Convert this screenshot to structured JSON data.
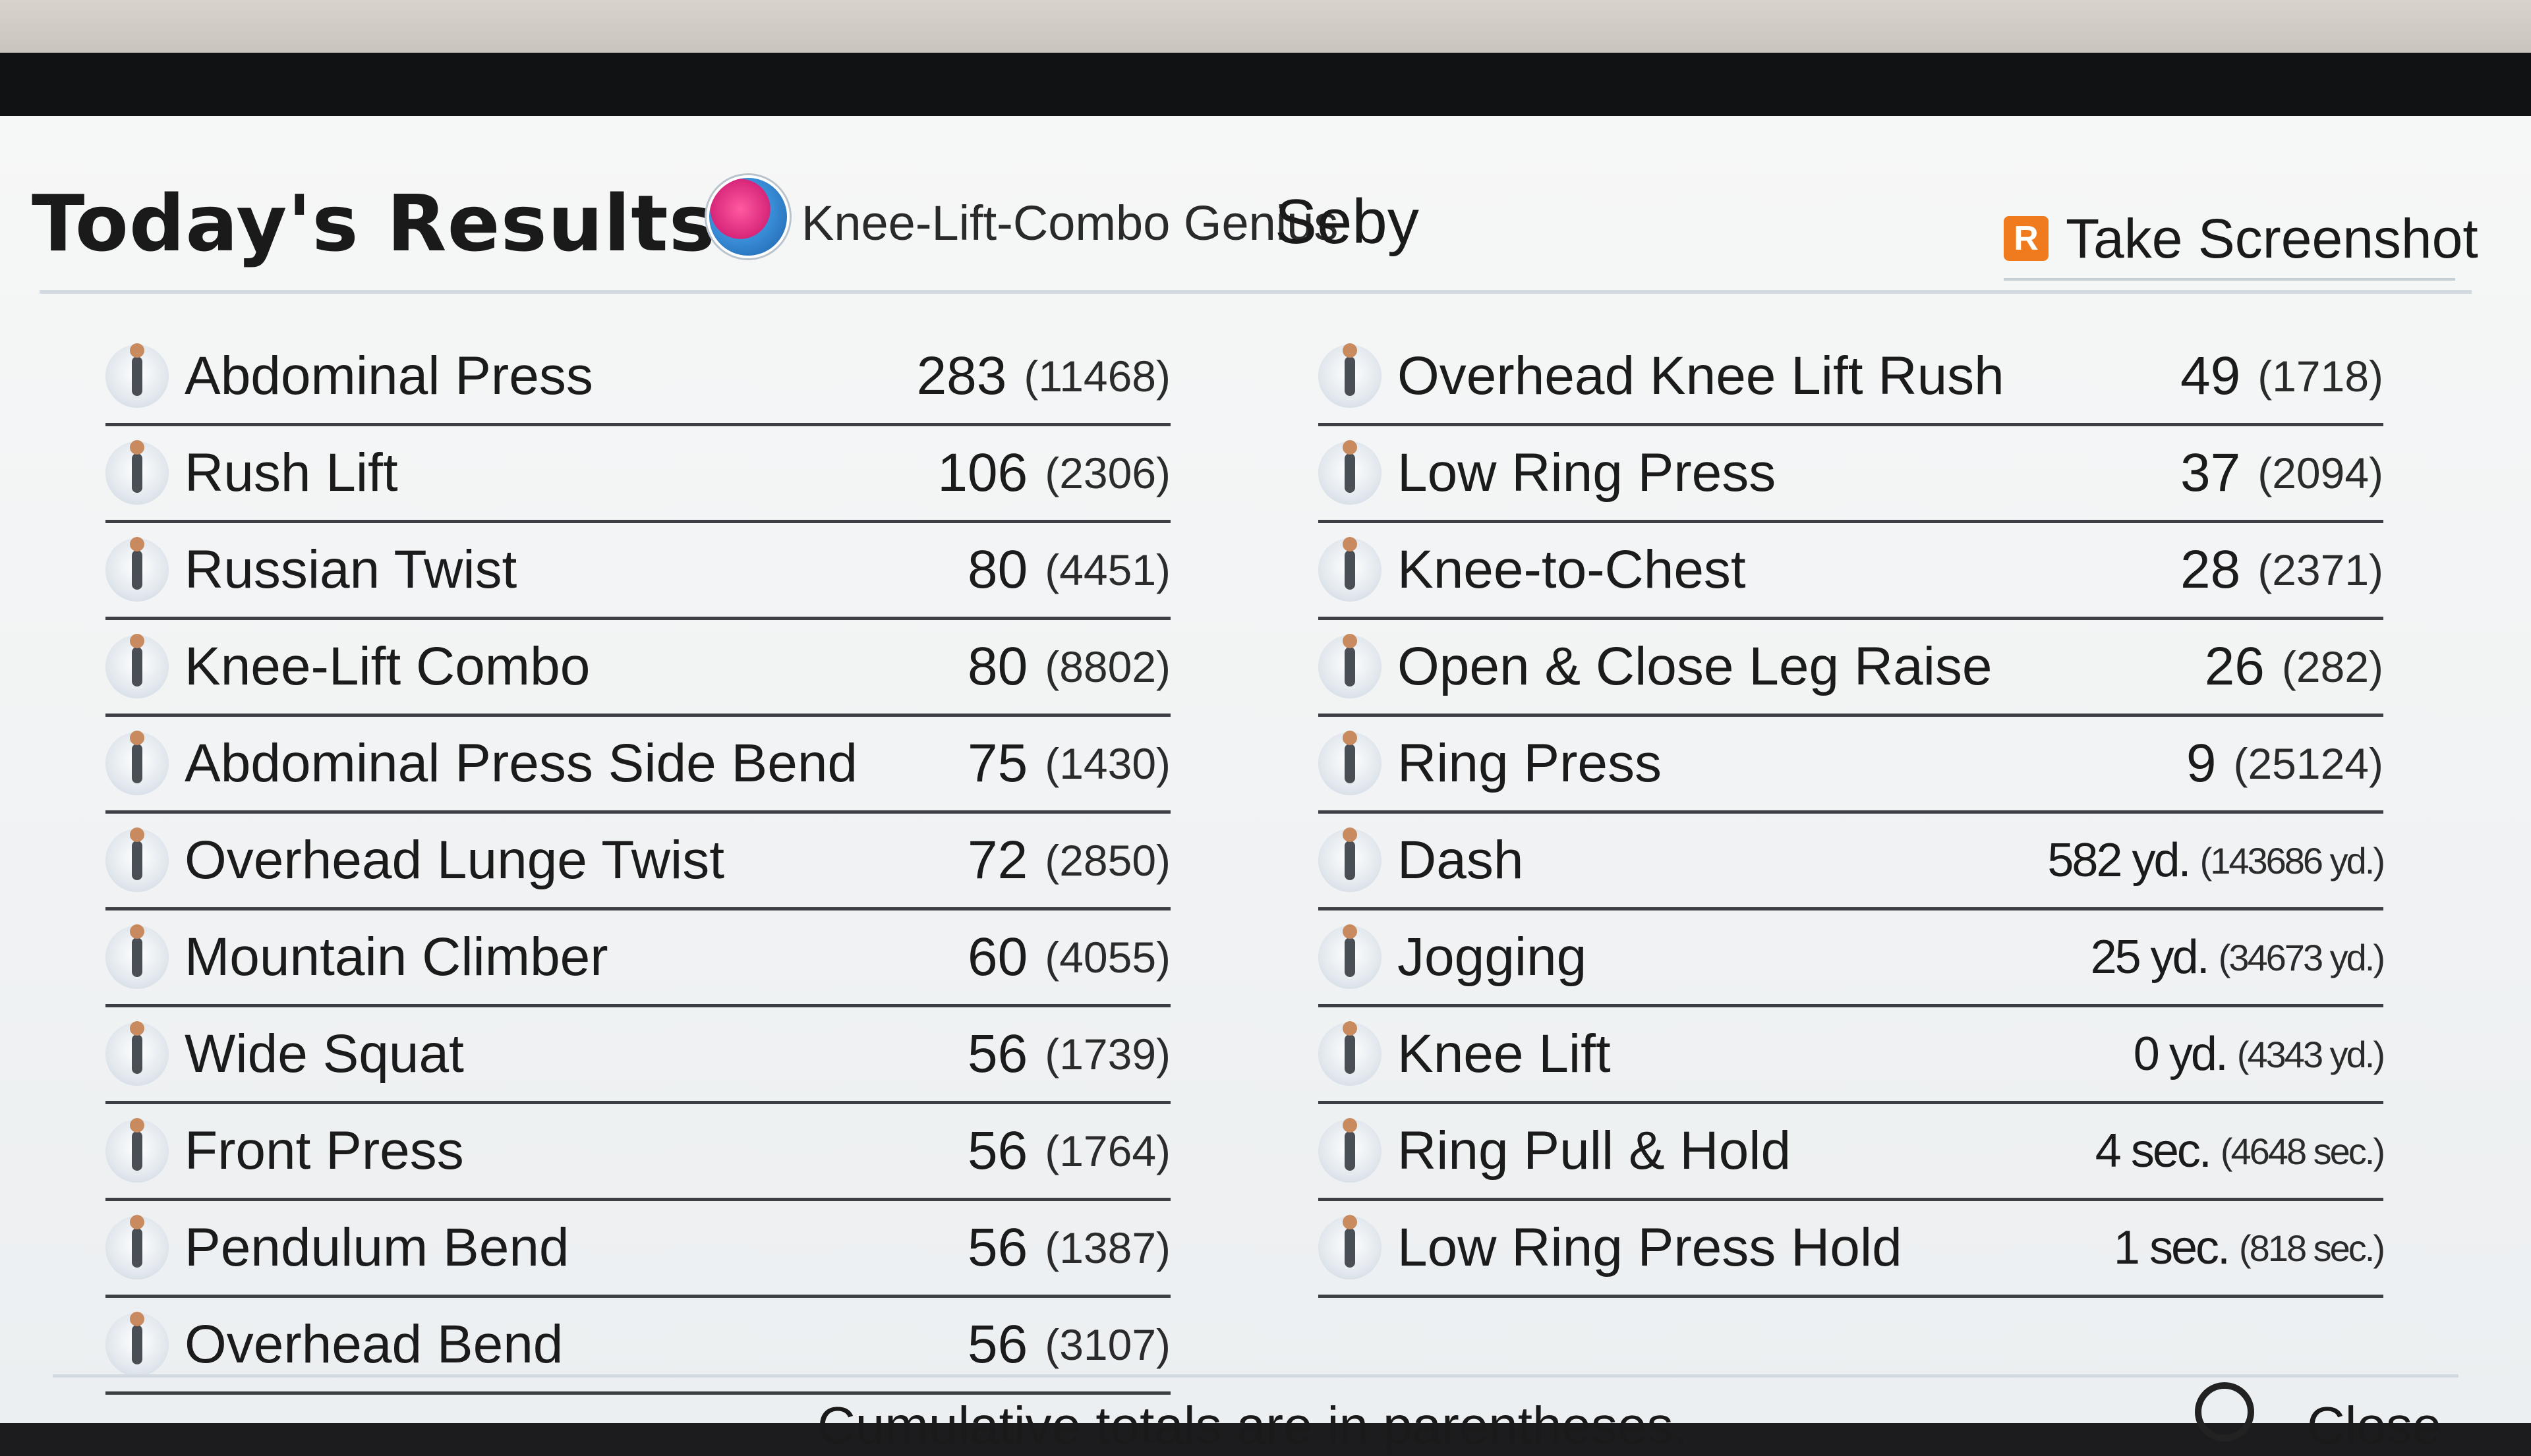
{
  "header": {
    "title": "Today's Results",
    "subtitle": "Knee-Lift-Combo Genius",
    "player_name": "Seby",
    "screenshot_button_key": "R",
    "screenshot_label": "Take Screenshot"
  },
  "left_exercises": [
    {
      "name": "Abdominal Press",
      "count": "283",
      "total": "(11468)"
    },
    {
      "name": "Rush Lift",
      "count": "106",
      "total": "(2306)"
    },
    {
      "name": "Russian Twist",
      "count": "80",
      "total": "(4451)"
    },
    {
      "name": "Knee-Lift Combo",
      "count": "80",
      "total": "(8802)"
    },
    {
      "name": "Abdominal Press Side Bend",
      "count": "75",
      "total": "(1430)"
    },
    {
      "name": "Overhead Lunge Twist",
      "count": "72",
      "total": "(2850)"
    },
    {
      "name": "Mountain Climber",
      "count": "60",
      "total": "(4055)"
    },
    {
      "name": "Wide Squat",
      "count": "56",
      "total": "(1739)"
    },
    {
      "name": "Front Press",
      "count": "56",
      "total": "(1764)"
    },
    {
      "name": "Pendulum Bend",
      "count": "56",
      "total": "(1387)"
    },
    {
      "name": "Overhead Bend",
      "count": "56",
      "total": "(3107)"
    }
  ],
  "right_exercises": [
    {
      "name": "Overhead Knee Lift Rush",
      "count": "49",
      "total": "(1718)"
    },
    {
      "name": "Low Ring Press",
      "count": "37",
      "total": "(2094)"
    },
    {
      "name": "Knee-to-Chest",
      "count": "28",
      "total": "(2371)"
    },
    {
      "name": "Open & Close Leg Raise",
      "count": "26",
      "total": "(282)"
    },
    {
      "name": "Ring Press",
      "count": "9",
      "total": "(25124)"
    },
    {
      "name": "Dash",
      "count": "582 yd.",
      "total": "(143686 yd.)"
    },
    {
      "name": "Jogging",
      "count": "25 yd.",
      "total": "(34673 yd.)"
    },
    {
      "name": "Knee Lift",
      "count": "0 yd.",
      "total": "(4343 yd.)"
    },
    {
      "name": "Ring Pull & Hold",
      "count": "4 sec.",
      "total": "(4648 sec.)"
    },
    {
      "name": "Low Ring Press Hold",
      "count": "1 sec.",
      "total": "(818 sec.)"
    }
  ],
  "footer": {
    "note": "Cumulative totals are in parentheses.",
    "close_label": "Close"
  },
  "colors": {
    "screen_bg": "#f2f4f5",
    "badge_orange": "#f07a1e",
    "row_rule": "#3c4045"
  },
  "icons": {
    "exercise": "exercise-figure-icon",
    "screenshot": "r-button-icon",
    "close": "close-button-icon"
  }
}
